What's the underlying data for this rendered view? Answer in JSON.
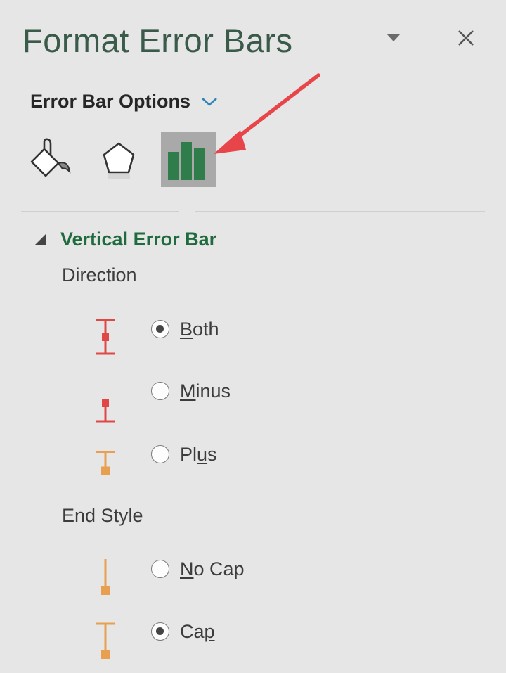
{
  "pane": {
    "title": "Format Error Bars"
  },
  "options_dropdown": {
    "label": "Error Bar Options"
  },
  "tabs": [
    {
      "name": "fill-line",
      "icon": "paint-bucket-icon"
    },
    {
      "name": "effects",
      "icon": "pentagon-icon"
    },
    {
      "name": "error-bar-options",
      "icon": "bar-chart-icon",
      "selected": true
    }
  ],
  "section": {
    "title": "Vertical Error Bar",
    "direction": {
      "label": "Direction",
      "options": [
        {
          "key": "B",
          "rest": "oth",
          "full": "Both",
          "checked": true,
          "icon": "error-bar-both-icon"
        },
        {
          "key": "M",
          "rest": "inus",
          "full": "Minus",
          "checked": false,
          "icon": "error-bar-minus-icon"
        },
        {
          "pre": "Pl",
          "key": "u",
          "rest": "s",
          "full": "Plus",
          "checked": false,
          "icon": "error-bar-plus-icon"
        }
      ]
    },
    "end_style": {
      "label": "End Style",
      "options": [
        {
          "key": "N",
          "rest": "o Cap",
          "full": "No Cap",
          "checked": false,
          "icon": "error-bar-no-cap-icon"
        },
        {
          "pre": "Ca",
          "key": "p",
          "rest": "",
          "full": "Cap",
          "checked": true,
          "icon": "error-bar-cap-icon"
        }
      ]
    }
  },
  "colors": {
    "background": "#e6e6e6",
    "title": "#3a5a4a",
    "section_title": "#1f6b3e",
    "selected_tab": "#a9a9a9",
    "chart_icon_green": "#2e7d4a",
    "error_bar_red": "#e04848",
    "error_bar_orange": "#e8a050",
    "annotation_arrow": "#e8454a"
  }
}
